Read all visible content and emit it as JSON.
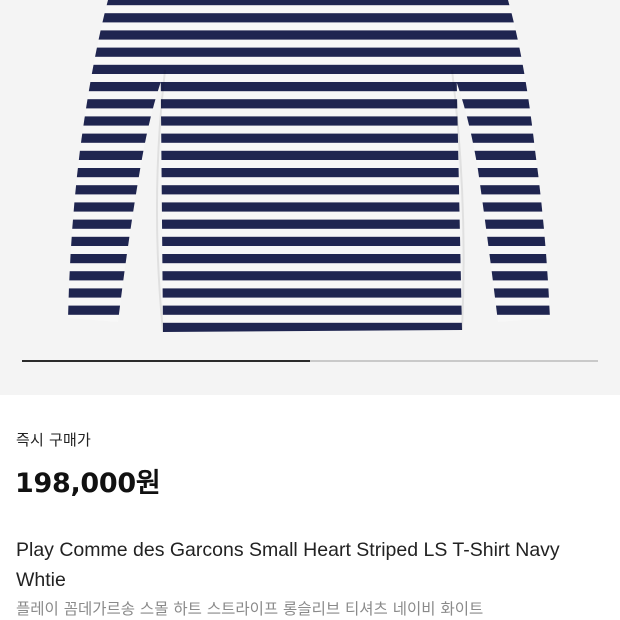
{
  "product": {
    "image_name": "striped-long-sleeve-tshirt",
    "stripe_colors": {
      "navy": "#1f2550",
      "white": "#f7f7f7"
    },
    "gallery_progress_fraction": 0.5,
    "buy_label": "즉시 구매가",
    "price": "198,000원",
    "title": "Play Comme des Garcons Small Heart Striped LS T-Shirt Navy Whtie",
    "subtitle": "플레이 꼼데가르송 스몰 하트 스트라이프 롱슬리브 티셔츠 네이비 화이트"
  }
}
